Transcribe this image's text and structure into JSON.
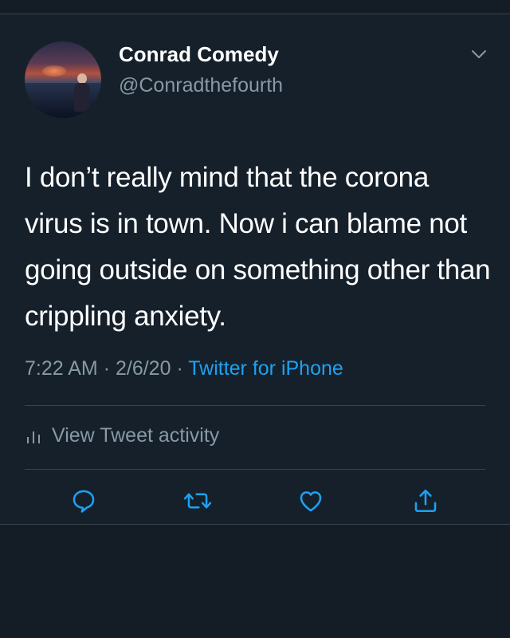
{
  "tweet": {
    "author": {
      "name": "Conrad Comedy",
      "handle": "@Conradthefourth"
    },
    "text": "I don’t really mind that the corona virus is in town. Now i can blame not going outside on something other than crippling anxiety.",
    "time": "7:22 AM",
    "date": "2/6/20",
    "separator": "·",
    "source": "Twitter for iPhone",
    "activity_label": "View Tweet activity"
  },
  "icons": {
    "menu": "chevron-down-icon",
    "activity": "bar-chart-icon",
    "reply": "reply-icon",
    "retweet": "retweet-icon",
    "like": "heart-icon",
    "share": "share-icon"
  },
  "colors": {
    "background": "#15202b",
    "text": "#ffffff",
    "secondary": "#8899a6",
    "accent": "#1da1f2",
    "divider": "#38444d"
  }
}
